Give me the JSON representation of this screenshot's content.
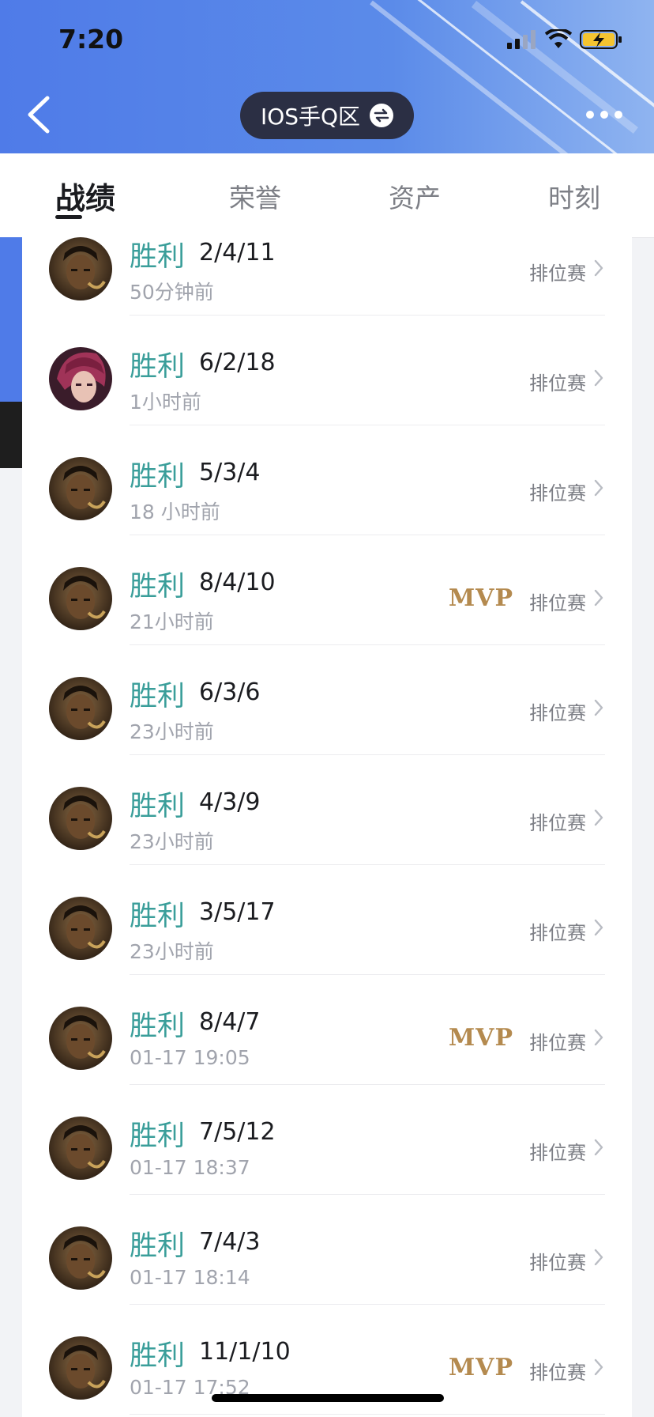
{
  "status": {
    "time": "7:20"
  },
  "header": {
    "server_label": "IOS手Q区"
  },
  "tabs": [
    {
      "label": "战绩",
      "active": true
    },
    {
      "label": "荣誉",
      "active": false
    },
    {
      "label": "资产",
      "active": false
    },
    {
      "label": "时刻",
      "active": false
    }
  ],
  "matches": [
    {
      "result": "胜利",
      "kda": "2/4/11",
      "time": "50分钟前",
      "mvp": "",
      "mode": "排位赛",
      "hero": "dark-hero"
    },
    {
      "result": "胜利",
      "kda": "6/2/18",
      "time": "1小时前",
      "mvp": "",
      "mode": "排位赛",
      "hero": "red-hair-hero"
    },
    {
      "result": "胜利",
      "kda": "5/3/4",
      "time": "18 小时前",
      "mvp": "",
      "mode": "排位赛",
      "hero": "dark-hero"
    },
    {
      "result": "胜利",
      "kda": "8/4/10",
      "time": "21小时前",
      "mvp": "MVP",
      "mode": "排位赛",
      "hero": "dark-hero"
    },
    {
      "result": "胜利",
      "kda": "6/3/6",
      "time": "23小时前",
      "mvp": "",
      "mode": "排位赛",
      "hero": "dark-hero"
    },
    {
      "result": "胜利",
      "kda": "4/3/9",
      "time": "23小时前",
      "mvp": "",
      "mode": "排位赛",
      "hero": "dark-hero"
    },
    {
      "result": "胜利",
      "kda": "3/5/17",
      "time": "23小时前",
      "mvp": "",
      "mode": "排位赛",
      "hero": "dark-hero"
    },
    {
      "result": "胜利",
      "kda": "8/4/7",
      "time": "01-17 19:05",
      "mvp": "MVP",
      "mode": "排位赛",
      "hero": "dark-hero"
    },
    {
      "result": "胜利",
      "kda": "7/5/12",
      "time": "01-17 18:37",
      "mvp": "",
      "mode": "排位赛",
      "hero": "dark-hero"
    },
    {
      "result": "胜利",
      "kda": "7/4/3",
      "time": "01-17 18:14",
      "mvp": "",
      "mode": "排位赛",
      "hero": "dark-hero"
    },
    {
      "result": "胜利",
      "kda": "11/1/10",
      "time": "01-17 17:52",
      "mvp": "MVP",
      "mode": "排位赛",
      "hero": "dark-hero"
    }
  ],
  "colors": {
    "win": "#3a9e9a",
    "mvp": "#b48a4f",
    "header_blue": "#4f7be8"
  }
}
